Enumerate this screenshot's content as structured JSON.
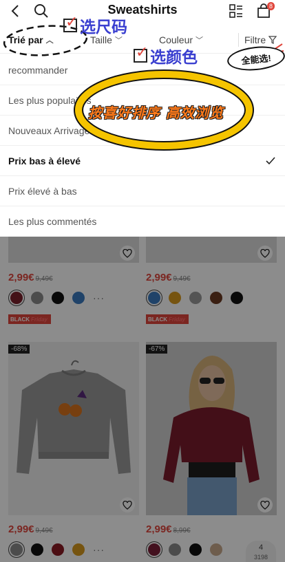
{
  "header": {
    "title": "Sweatshirts",
    "cart_count": "8"
  },
  "filters": {
    "sort_label": "Trié par",
    "size_label": "Taille",
    "color_label": "Couleur",
    "filter_label": "Filtre"
  },
  "sort_options": [
    {
      "label": "recommander",
      "selected": false
    },
    {
      "label": "Les plus populaires",
      "selected": false
    },
    {
      "label": "Nouveaux Arrivages",
      "selected": false
    },
    {
      "label": "Prix bas à élevé",
      "selected": true
    },
    {
      "label": "Prix élevé à bas",
      "selected": false
    },
    {
      "label": "Les plus commentés",
      "selected": false
    }
  ],
  "products": [
    {
      "price": "2,99€",
      "old_price": "9,49€",
      "swatches": [
        "#7a1f2b",
        "#8a8a8a",
        "#111111",
        "#3b7bbf"
      ],
      "more": "···",
      "promo": "BLACK",
      "promo_suffix": "Friday"
    },
    {
      "price": "2,99€",
      "old_price": "9,49€",
      "swatches": [
        "#3b7bbf",
        "#d89a1e",
        "#9a9a9a",
        "#6b3a22",
        "#111111"
      ],
      "promo": "BLACK",
      "promo_suffix": "Friday"
    },
    {
      "price": "2,99€",
      "old_price": "9,49€",
      "discount": "-68%",
      "swatches": [
        "#8a8a8a",
        "#111111",
        "#8b1a24",
        "#d89a1e"
      ],
      "more": "···"
    },
    {
      "price": "2,99€",
      "old_price": "8,99€",
      "discount": "-67%",
      "swatches": [
        "#7a1f3a",
        "#8a8a8a",
        "#111111",
        "#c9a98c"
      ]
    }
  ],
  "pagination": {
    "current": "4",
    "total": "3198"
  },
  "annotations": {
    "size_note": "选尺码",
    "color_note": "选颜色",
    "all_note": "全能选!",
    "sort_note": "按喜好排序 高效浏览"
  },
  "colors": {
    "accent": "#e0463c",
    "annotation_blue": "#3a3fd0",
    "highlight_yellow": "#f5c400",
    "highlight_orange": "#ff7a1a"
  }
}
